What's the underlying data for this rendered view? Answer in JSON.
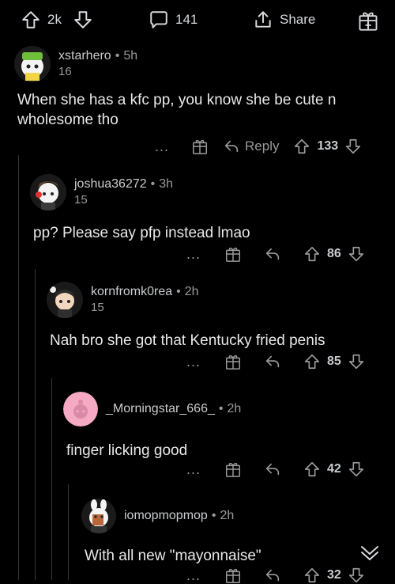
{
  "topbar": {
    "upvotes": "2k",
    "comments": "141",
    "share_label": "Share"
  },
  "comments": [
    {
      "user": "xstarhero",
      "time": "5h",
      "flair": "16",
      "body": "When she has a kfc pp, you know she be cute n wholesome tho",
      "score": "133",
      "reply_label": "Reply"
    },
    {
      "user": "joshua36272",
      "time": "3h",
      "flair": "15",
      "body": "pp? Please say pfp instead lmao",
      "score": "86"
    },
    {
      "user": "kornfromk0rea",
      "time": "2h",
      "flair": "15",
      "body": "Nah bro she got that Kentucky fried penis",
      "score": "85"
    },
    {
      "user": "_Morningstar_666_",
      "time": "2h",
      "flair": "",
      "body": "finger licking good",
      "score": "42"
    },
    {
      "user": "iomopmopmop",
      "time": "2h",
      "flair": "",
      "body": "With all new \"mayonnaise\"",
      "score": "32"
    }
  ],
  "more_label": "...",
  "separator": "•",
  "colors": {
    "background": "#000000",
    "thread_line": "#343536",
    "text": "#d7dadc",
    "muted": "#9a9a9a",
    "avatar_pink": "#f6a9c2"
  }
}
